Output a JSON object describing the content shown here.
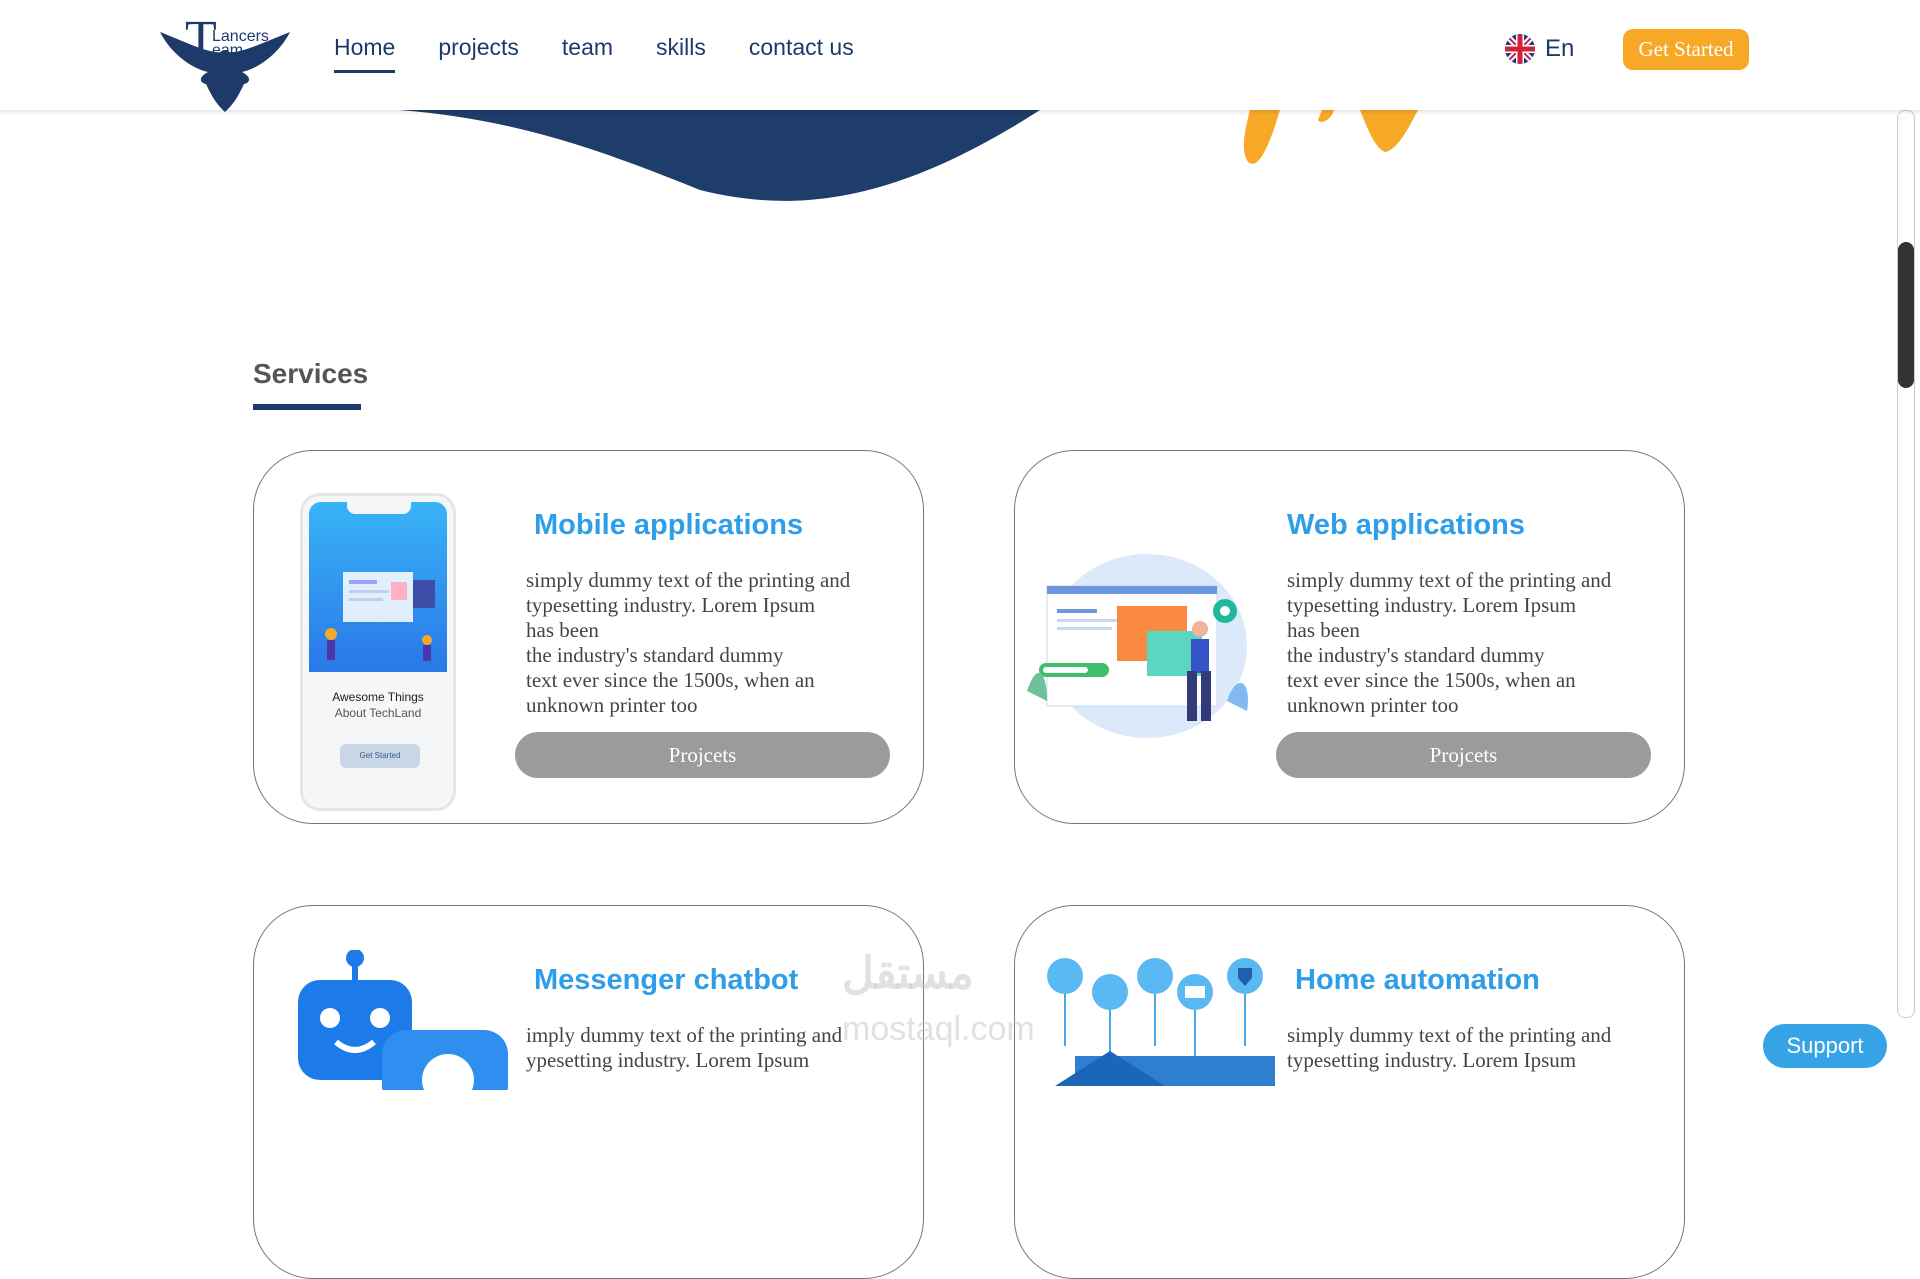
{
  "header": {
    "logo_big": "T",
    "logo_line1": "Lancers",
    "logo_line2": "eam",
    "nav": [
      "Home",
      "projects",
      "team",
      "skills",
      "contact us"
    ],
    "active_nav": "Home",
    "language": "En",
    "cta_label": "Get Started"
  },
  "services": {
    "title": "Services",
    "cards": [
      {
        "title": "Mobile applications",
        "text": "simply dummy text of the printing and\ntypesetting industry. Lorem Ipsum\n has been\nthe industry's standard dummy\ntext ever since the 1500s, when an\nunknown printer too",
        "button": "Projcets",
        "phone_title": "Awesome Things",
        "phone_sub": "About TechLand",
        "phone_btn": "Get Started"
      },
      {
        "title": "Web applications",
        "text": "simply dummy text of the printing and\ntypesetting industry. Lorem Ipsum\n has been\nthe industry's standard dummy\ntext ever since the 1500s, when an\nunknown printer too",
        "button": "Projcets"
      },
      {
        "title": "Messenger chatbot",
        "text": "imply dummy text of the printing and\nypesetting industry. Lorem Ipsum"
      },
      {
        "title": "Home automation",
        "text": "simply dummy text of the printing and\ntypesetting industry. Lorem Ipsum"
      }
    ]
  },
  "support_label": "Support",
  "watermark": {
    "arabic": "مستقل",
    "latin": "mostaql.com"
  },
  "colors": {
    "navy": "#1e3a6b",
    "accent_orange": "#f7a827",
    "title_blue": "#2f9ee9",
    "button_gray": "#9b9b9b",
    "support_blue": "#36a3e6"
  }
}
